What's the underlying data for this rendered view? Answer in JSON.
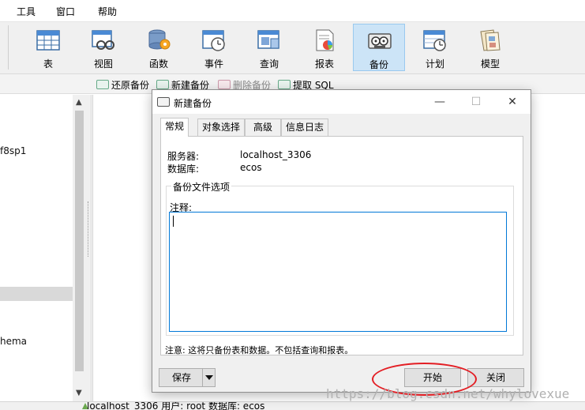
{
  "menubar": {
    "items": [
      {
        "label": "工具"
      },
      {
        "label": "窗口"
      },
      {
        "label": "帮助"
      }
    ]
  },
  "toolbar": {
    "items": [
      {
        "label": "表",
        "icon": "table-icon"
      },
      {
        "label": "视图",
        "icon": "view-icon"
      },
      {
        "label": "函数",
        "icon": "function-icon"
      },
      {
        "label": "事件",
        "icon": "event-icon"
      },
      {
        "label": "查询",
        "icon": "query-icon"
      },
      {
        "label": "报表",
        "icon": "report-icon"
      },
      {
        "label": "备份",
        "icon": "backup-icon",
        "active": true
      },
      {
        "label": "计划",
        "icon": "schedule-icon"
      },
      {
        "label": "模型",
        "icon": "model-icon"
      }
    ]
  },
  "subbar": {
    "restore": "还原备份",
    "new": "新建备份",
    "delete": "删除备份",
    "extract": "提取 SQL"
  },
  "tree": {
    "item1": "f8sp1",
    "item2": "hema"
  },
  "statusbar": {
    "text": "localhost_3306   用户: root   数据库: ecos"
  },
  "dialog": {
    "title": "新建备份",
    "window_controls": {
      "minimize": "—",
      "maximize": "☐",
      "close": "✕"
    },
    "tabs": [
      {
        "label": "常规",
        "active": true
      },
      {
        "label": "对象选择"
      },
      {
        "label": "高级"
      },
      {
        "label": "信息日志"
      }
    ],
    "server_label": "服务器:",
    "server_value": "localhost_3306",
    "database_label": "数据库:",
    "database_value": "ecos",
    "group_label": "备份文件选项",
    "comment_label": "注释:",
    "comment_value": "",
    "note": "注意: 这将只备份表和数据。不包括查询和报表。",
    "save_label": "保存",
    "start_label": "开始",
    "close_label": "关闭"
  },
  "watermark": "https://blog.csdn.net/whylovexue",
  "colors": {
    "accent": "#0078d7",
    "active_tool_bg": "#cce4f7",
    "annotation": "#e31e24"
  }
}
